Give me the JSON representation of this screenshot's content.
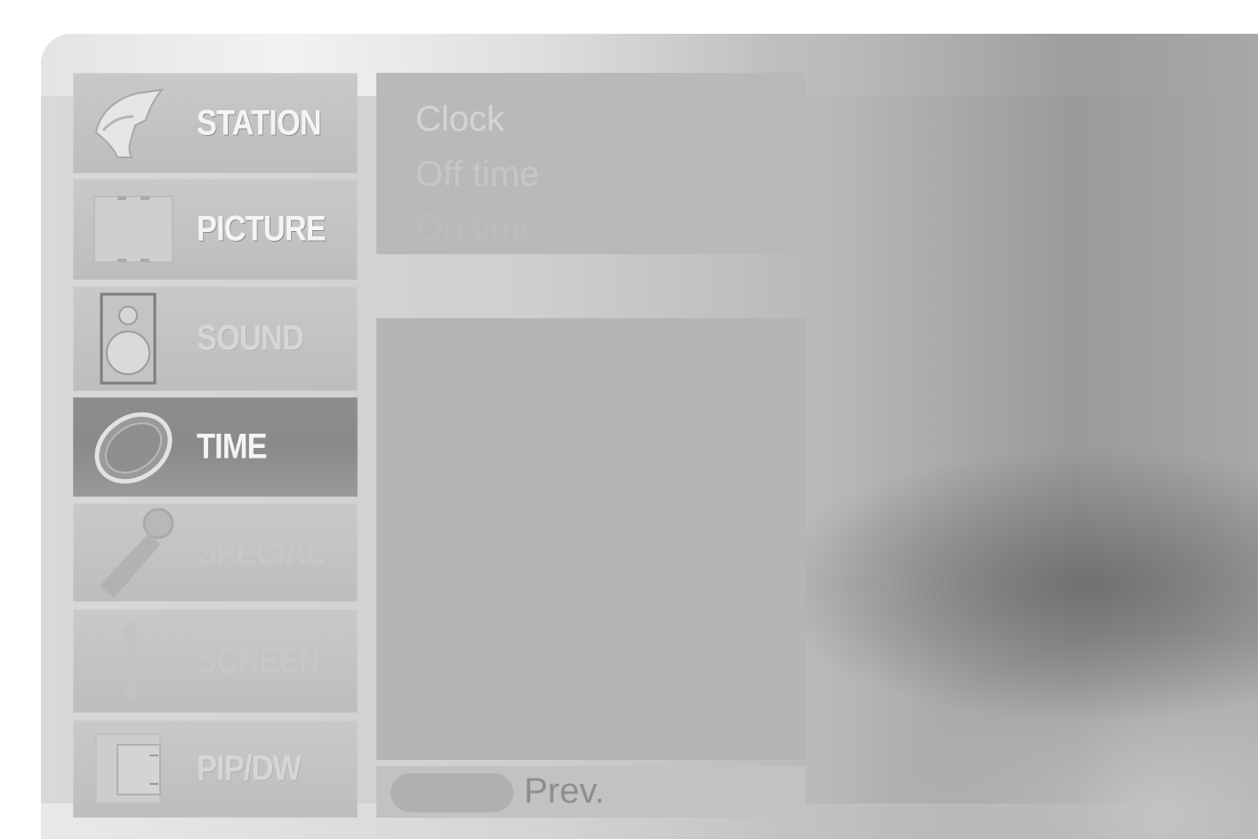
{
  "menu": {
    "items": [
      {
        "id": "station",
        "label": "STATION",
        "icon": "satellite-dish-icon",
        "state": "bright"
      },
      {
        "id": "picture",
        "label": "PICTURE",
        "icon": "film-frame-icon",
        "state": "bright"
      },
      {
        "id": "sound",
        "label": "SOUND",
        "icon": "speaker-icon",
        "state": "faded"
      },
      {
        "id": "time",
        "label": "TIME",
        "icon": "clock-icon",
        "state": "selected"
      },
      {
        "id": "special",
        "label": "SPECIAL",
        "icon": "key-icon",
        "state": "ghost"
      },
      {
        "id": "screen",
        "label": "SCREEN",
        "icon": "arrows-icon",
        "state": "ghost"
      },
      {
        "id": "pipdw",
        "label": "PIP/DW",
        "icon": "pip-window-icon",
        "state": "faded"
      }
    ],
    "selected": "TIME"
  },
  "submenu": {
    "items": [
      "Clock",
      "Off time",
      "On time"
    ]
  },
  "footer": {
    "prev_label": "Prev."
  }
}
